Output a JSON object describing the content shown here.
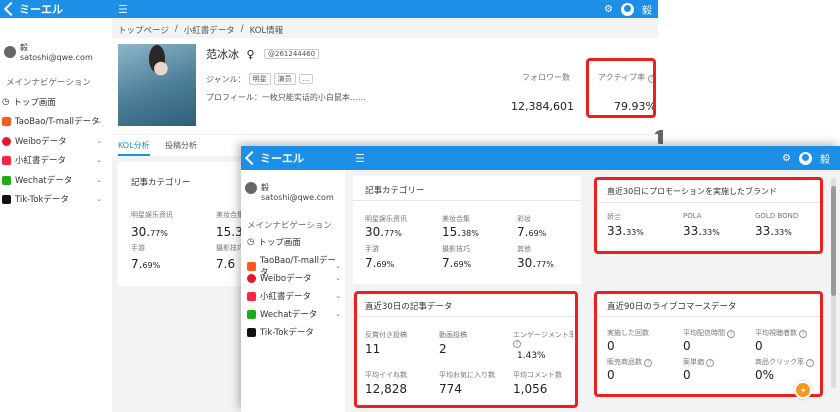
{
  "back": {
    "app_name": "ミーエル",
    "user": {
      "name": "毅",
      "email": "satoshi@qwe.com"
    },
    "nav_heading": "メインナビゲーション",
    "nav": [
      {
        "label": "トップ画面"
      },
      {
        "label": "TaoBao/T-mallデータ"
      },
      {
        "label": "Weiboデータ"
      },
      {
        "label": "小紅書データ"
      },
      {
        "label": "Wechatデータ"
      },
      {
        "label": "Tik-Tokデータ"
      }
    ],
    "breadcrumb": [
      "トップページ",
      "/",
      "小紅書データ",
      "/",
      "KOL情報"
    ],
    "kol": {
      "name": "范冰冰",
      "id": "@261244460",
      "genre_label": "ジャンル：",
      "genres": [
        "明星",
        "演员",
        "..."
      ],
      "profile_label": "プロフィール：",
      "profile_text": "一枚只能实话的小白鼠本……",
      "followers_label": "フォロワー数",
      "followers_value": "12,384,601",
      "active_label": "アクティブ率",
      "active_value": "79.93%"
    },
    "tabs": [
      "KOL分析",
      "投稿分析"
    ],
    "category_title": "記事カテゴリー",
    "categories": [
      {
        "label": "明星娱乐资讯",
        "value": "30.",
        "pct": "77%"
      },
      {
        "label": "美妆合集",
        "value": "15.3",
        "pct": ""
      },
      {
        "label": "手游",
        "value": "7.",
        "pct": "69%"
      },
      {
        "label": "摄影技巧",
        "value": "7.6",
        "pct": ""
      }
    ]
  },
  "front": {
    "app_name": "ミーエル",
    "user": {
      "name": "毅",
      "email": "satoshi@qwe.com"
    },
    "nav_heading": "メインナビゲーション",
    "nav": [
      {
        "label": "トップ画面"
      },
      {
        "label": "TaoBao/T-mallデータ"
      },
      {
        "label": "Weiboデータ"
      },
      {
        "label": "小紅書データ"
      },
      {
        "label": "Wechatデータ"
      },
      {
        "label": "Tik-Tokデータ"
      }
    ],
    "category": {
      "title": "記事カテゴリー",
      "items": [
        {
          "label": "明星娱乐资讯",
          "main": "30.",
          "small": "77%"
        },
        {
          "label": "美妆合集",
          "main": "15.",
          "small": "38%"
        },
        {
          "label": "彩妆",
          "main": "7.",
          "small": "69%"
        },
        {
          "label": "手游",
          "main": "7.",
          "small": "69%"
        },
        {
          "label": "摄影技巧",
          "main": "7.",
          "small": "69%"
        },
        {
          "label": "其他",
          "main": "30.",
          "small": "77%"
        }
      ]
    },
    "brands": {
      "title": "直近30日にプロモーションを実施したブランド",
      "items": [
        {
          "label": "娇兰",
          "main": "33.",
          "small": "33%"
        },
        {
          "label": "POLA",
          "main": "33.",
          "small": "33%"
        },
        {
          "label": "GOLD BOND",
          "main": "33.",
          "small": "33%"
        }
      ]
    },
    "articles": {
      "title": "直近30日の記事データ",
      "items": [
        {
          "label": "反賞付き投稿",
          "value": "11"
        },
        {
          "label": "動画投稿",
          "value": "2"
        },
        {
          "label": "エンゲージメント率",
          "value": "1.43%"
        },
        {
          "label": "平均イイね数",
          "value": "12,828"
        },
        {
          "label": "平均お気に入り数",
          "value": "774"
        },
        {
          "label": "平均コメント数",
          "value": "1,056"
        }
      ]
    },
    "live": {
      "title": "直近90日のライブコマースデータ",
      "items": [
        {
          "label": "実施した回数",
          "value": "0"
        },
        {
          "label": "平均配信時間",
          "value": "0"
        },
        {
          "label": "平均視聴者数",
          "value": "0"
        },
        {
          "label": "販売商品数",
          "value": "0"
        },
        {
          "label": "案単価",
          "value": "0"
        },
        {
          "label": "商品クリック率",
          "value": "0%"
        }
      ]
    }
  },
  "colors": {
    "topbar": "#1e8fe6",
    "highlight": "#ee1f1f"
  }
}
